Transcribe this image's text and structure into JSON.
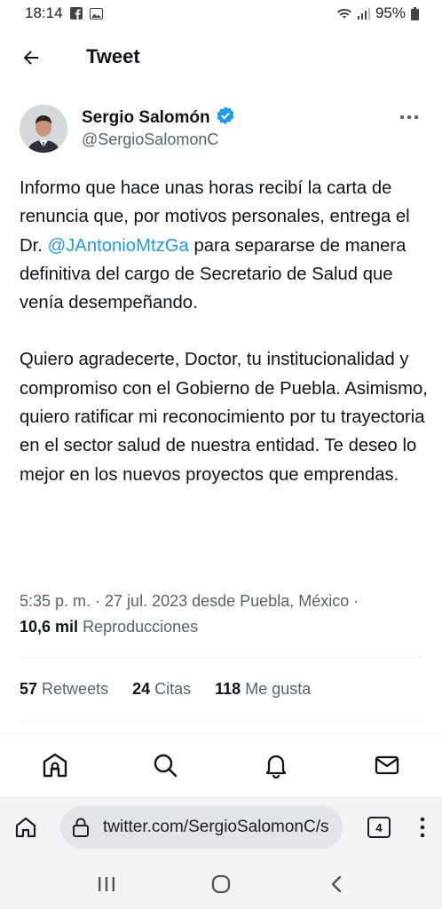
{
  "status_bar": {
    "time": "18:14",
    "battery": "95%",
    "icons": [
      "facebook-icon",
      "gallery-icon",
      "wifi-icon",
      "signal-icon",
      "battery-icon"
    ]
  },
  "header": {
    "title": "Tweet",
    "back_icon": "arrow-left-icon"
  },
  "tweet": {
    "author_name": "Sergio Salomón",
    "author_handle": "@SergioSalomonC",
    "verified_color": "#1d9bf0",
    "paragraph1_before": "Informo que hace unas horas recibí la carta de renuncia que, por motivos personales, entrega el Dr. ",
    "mention": "@JAntonioMtzGa",
    "paragraph1_after": " para separarse de manera definitiva del cargo de Secretario de Salud que venía desempeñando.",
    "paragraph2": "Quiero agradecerte, Doctor, tu institucionalidad y compromiso con el Gobierno de Puebla. Asimismo, quiero ratificar mi reconocimiento por tu trayectoria en el sector salud de nuestra entidad. Te deseo lo mejor en los nuevos proyectos que emprendas.",
    "timestamp_line": "5:35 p. m. · 27 jul. 2023 desde Puebla, México ·",
    "views_count": "10,6 mil",
    "views_label": "Reproducciones"
  },
  "stats": {
    "retweets_count": "57",
    "retweets_label": "Retweets",
    "quotes_count": "24",
    "quotes_label": "Citas",
    "likes_count": "118",
    "likes_label": "Me gusta"
  },
  "bottom_nav": {
    "items": [
      "home-icon",
      "search-icon",
      "notifications-icon",
      "messages-icon"
    ]
  },
  "browser": {
    "url": "twitter.com/SergioSalomonC/s",
    "tab_count": "4"
  },
  "colors": {
    "accent": "#1d9bf0",
    "text_primary": "#0f1419",
    "text_secondary": "#536471"
  }
}
